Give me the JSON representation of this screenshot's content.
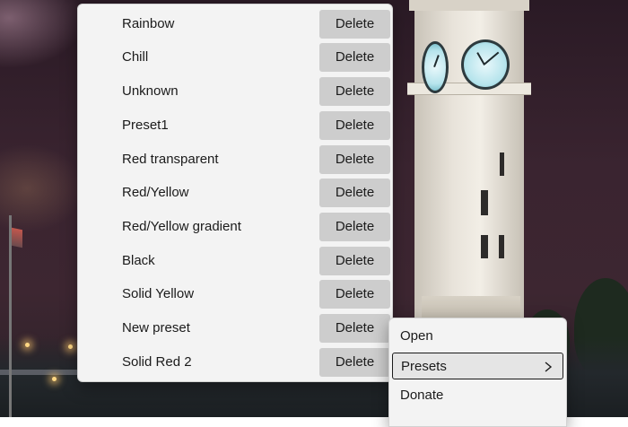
{
  "preset_menu": {
    "items": [
      {
        "name": "Rainbow",
        "action": "Delete"
      },
      {
        "name": "Chill",
        "action": "Delete"
      },
      {
        "name": "Unknown",
        "action": "Delete"
      },
      {
        "name": "Preset1",
        "action": "Delete"
      },
      {
        "name": "Red transparent",
        "action": "Delete"
      },
      {
        "name": "Red/Yellow",
        "action": "Delete"
      },
      {
        "name": "Red/Yellow gradient",
        "action": "Delete"
      },
      {
        "name": "Black",
        "action": "Delete"
      },
      {
        "name": "Solid Yellow",
        "action": "Delete"
      },
      {
        "name": "New preset",
        "action": "Delete"
      },
      {
        "name": "Solid Red 2",
        "action": "Delete"
      }
    ]
  },
  "context_menu": {
    "open_label": "Open",
    "presets_label": "Presets",
    "donate_label": "Donate",
    "presets_icon": "chevron-right-icon"
  },
  "colors": {
    "menu_background": "#f3f3f3",
    "button_background": "#cdcdcd",
    "highlight_border": "#1b1b1b"
  }
}
